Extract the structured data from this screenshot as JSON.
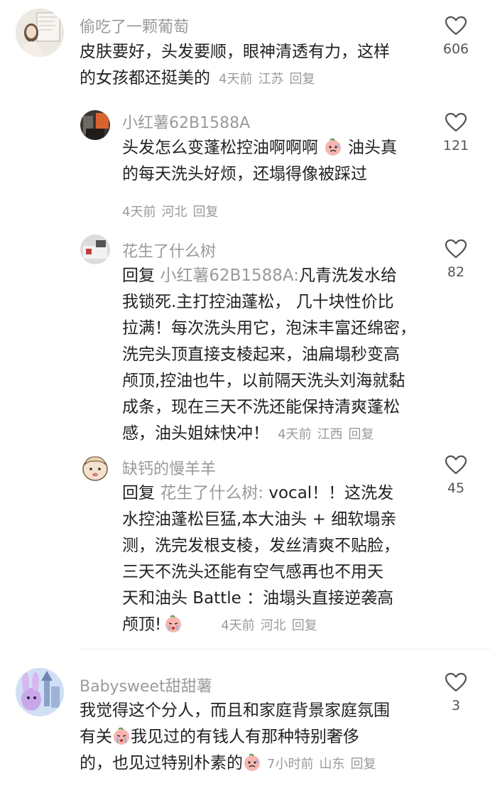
{
  "comments": [
    {
      "username": "偷吃了一颗葡萄",
      "lines": [
        "皮肤要好，头发要顺，眼神清透有力，这样",
        "的女孩都还挺美的"
      ],
      "time": "4天前",
      "location": "江苏",
      "reply_label": "回复",
      "likes": "606"
    },
    {
      "username": "小红薯62B1588A",
      "lines": [
        "头发怎么变蓬松控油啊啊啊",
        "油头真",
        "的每天洗头好烦，还塌得像被踩过"
      ],
      "time": "4天前",
      "location": "河北",
      "reply_label": "回复",
      "likes": "121"
    },
    {
      "username": "花生了什么树",
      "reply_prefix": "回复",
      "reply_target": "小红薯62B1588A:",
      "lines": [
        "凡青洗发水给",
        "我锁死.主打控油蓬松， 几十块性价比",
        "拉满！每次洗头用它，泡沫丰富还绵密，",
        "洗完头顶直接支棱起来，油扁塌秒变高",
        "颅顶,控油也牛，以前隔天洗头刘海就黏",
        "成条，现在三天不洗还能保持清爽蓬松",
        "感，油头姐妹快冲！"
      ],
      "time": "4天前",
      "location": "江西",
      "reply_label": "回复",
      "likes": "82"
    },
    {
      "username": "缺钙的慢羊羊",
      "reply_prefix": "回复",
      "reply_target": "花生了什么树:",
      "lines": [
        " vocal！！这洗发",
        "水控油蓬松巨猛,本大油头 + 细软塌亲",
        "测，洗完发根支棱，发丝清爽不贴脸，",
        "三天不洗头还能有空气感再也不用天",
        "天和油头 Battle ：油塌头直接逆袭高",
        "颅顶!"
      ],
      "time": "4天前",
      "location": "河北",
      "reply_label": "回复",
      "likes": "45"
    },
    {
      "username": "Babysweet甜甜薯",
      "lines": [
        "我觉得这个分人，而且和家庭背景家庭氛围",
        "有关",
        "我见过的有钱人有那种特别奢侈",
        "的，也见过特别朴素的"
      ],
      "time": "7小时前",
      "location": "山东",
      "reply_label": "回复",
      "likes": "3"
    }
  ],
  "icons": {
    "like": "heart-outline-icon",
    "emoji_sweat": "sweat-emoji-icon",
    "emoji_cry": "crying-emoji-icon"
  },
  "colors": {
    "text": "#222222",
    "meta": "#9a9a9a",
    "heart": "#555555"
  }
}
